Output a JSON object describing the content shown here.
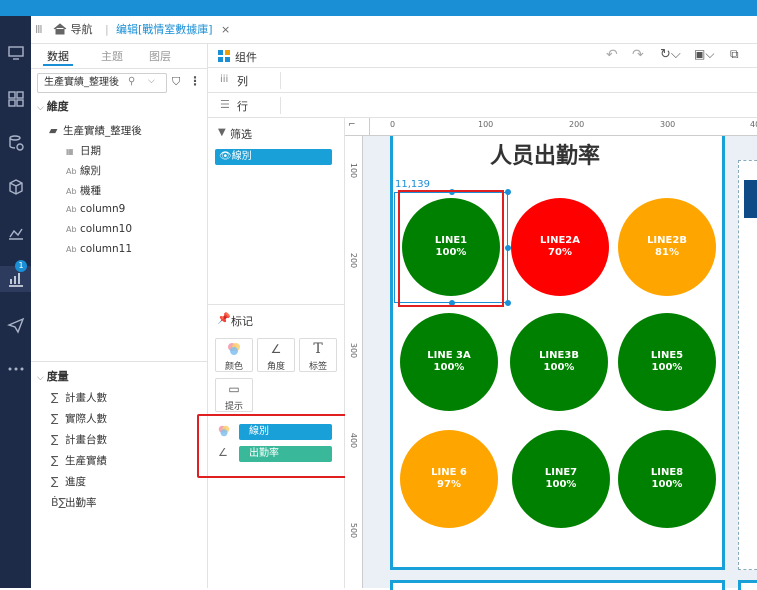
{
  "tabs": {
    "home_label": "导航",
    "edit_tab_label": "编辑[戰情室數據庫]"
  },
  "data_panel": {
    "tabs": [
      "数据",
      "主题",
      "图层"
    ],
    "source_name": "生產實績_整理後",
    "dimension_title": "維度",
    "dataset_name": "生產實績_整理後",
    "dimension_fields": [
      "日期",
      "線別",
      "機種",
      "column9",
      "column10",
      "column11"
    ],
    "measure_title": "度量",
    "measure_fields": [
      "計畫人數",
      "實際人數",
      "計畫台數",
      "生產實績",
      "進度",
      "出勤率"
    ]
  },
  "props_panel": {
    "component_label": "组件",
    "columns_label": "列",
    "rows_label": "行",
    "filter_label": "筛选",
    "filter_pill": "線別",
    "mark_label": "标记",
    "mark_buttons": [
      "颜色",
      "角度",
      "标签",
      "提示"
    ],
    "mark_color_pill": "線別",
    "mark_angle_pill": "出勤率"
  },
  "nav_badge": "1",
  "canvas": {
    "title": "人员出勤率",
    "coord_readout": "11,139",
    "ruler_h_labels": [
      "0",
      "100",
      "200",
      "300",
      "40"
    ],
    "ruler_v_labels": [
      "100",
      "200",
      "300",
      "400",
      "500"
    ]
  },
  "circles": [
    {
      "name": "LINE1",
      "value": "100%",
      "color": "#008000"
    },
    {
      "name": "LINE2A",
      "value": "70%",
      "color": "#ff0000"
    },
    {
      "name": "LINE2B",
      "value": "81%",
      "color": "#ffa500"
    },
    {
      "name": "LINE 3A",
      "value": "100%",
      "color": "#008000"
    },
    {
      "name": "LINE3B",
      "value": "100%",
      "color": "#008000"
    },
    {
      "name": "LINE5",
      "value": "100%",
      "color": "#008000"
    },
    {
      "name": "LINE 6",
      "value": "97%",
      "color": "#ffa500"
    },
    {
      "name": "LINE7",
      "value": "100%",
      "color": "#008000"
    },
    {
      "name": "LINE8",
      "value": "100%",
      "color": "#008000"
    }
  ],
  "colors": {
    "accent": "#1a8fd6",
    "nav_bg": "#1d2a48",
    "pill_blue": "#1aa0d8",
    "pill_teal": "#3ab89a",
    "highlight_red": "#e02020"
  }
}
